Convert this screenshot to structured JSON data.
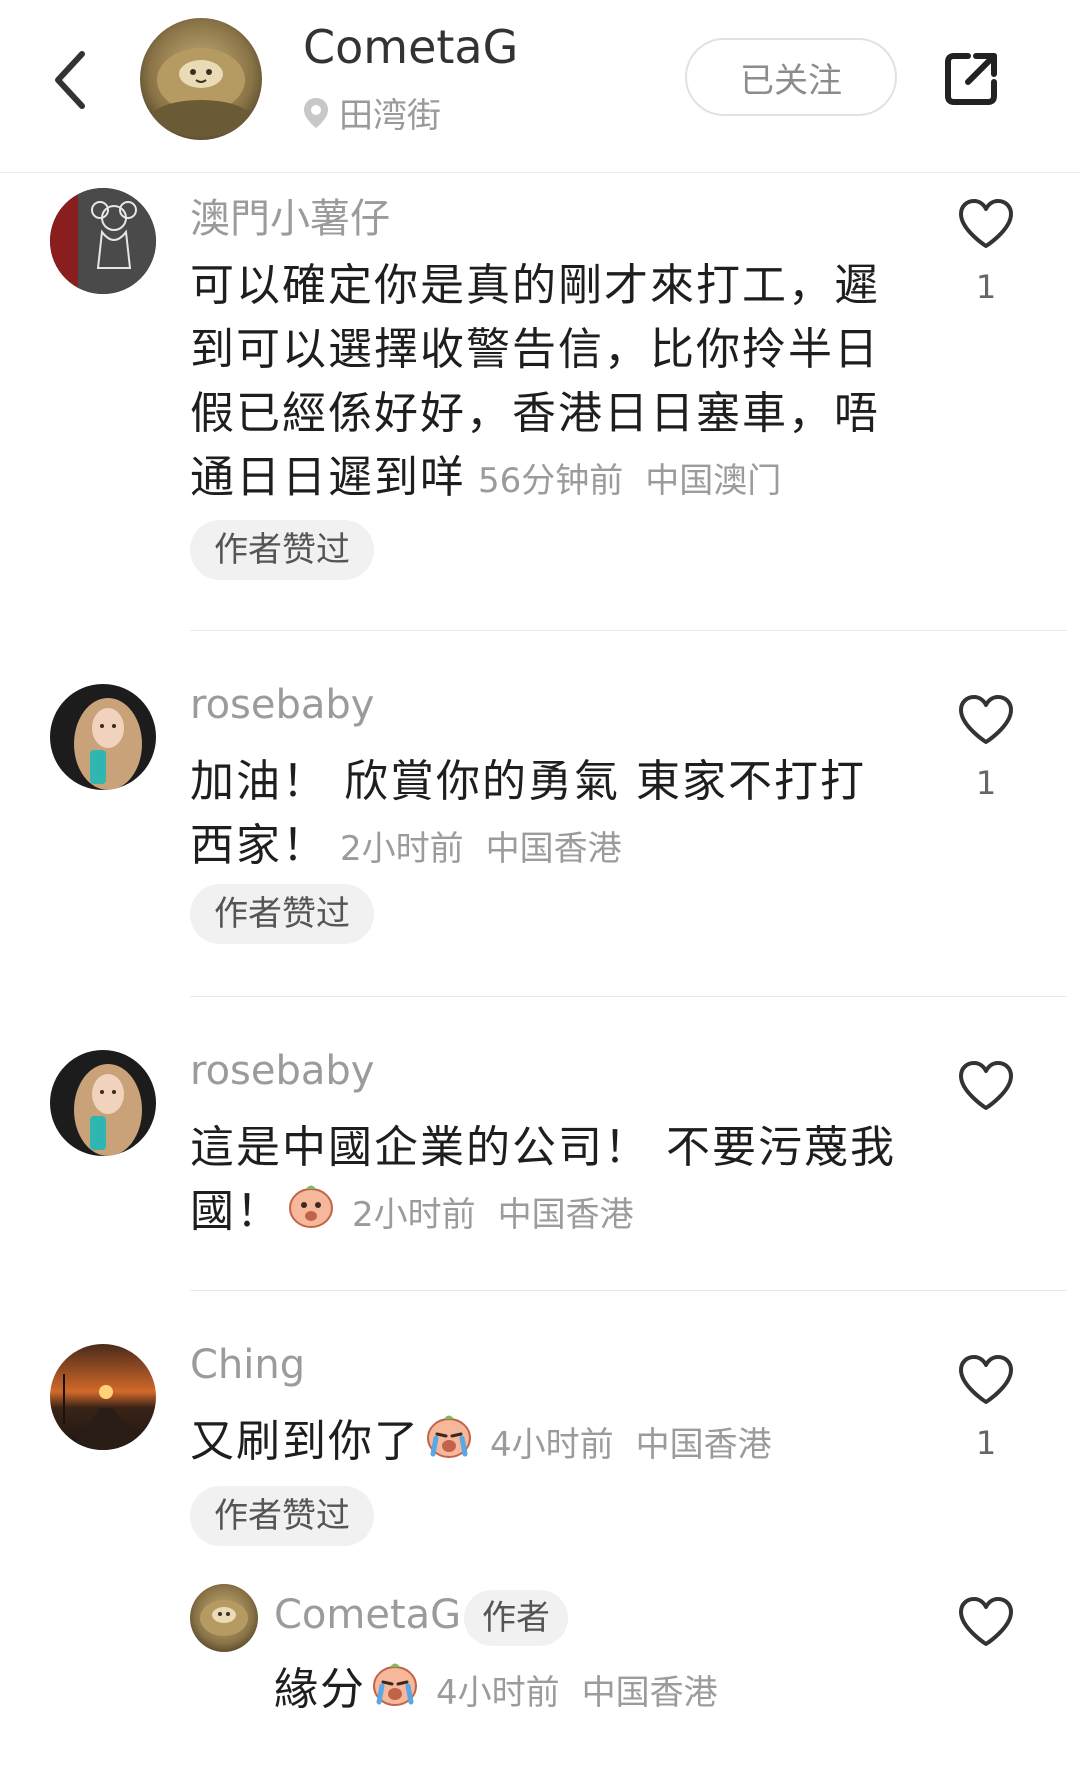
{
  "header": {
    "name": "CometaG",
    "location": "田湾街",
    "follow_label": "已关注",
    "back_icon": "chevron-left-icon",
    "share_icon": "share-external-icon"
  },
  "comments": [
    {
      "username": "澳門小薯仔",
      "text": "可以確定你是真的剛才來打工，遲到可以選擇收警告信，比你拎半日假已經係好好，香港日日塞車，唔通日日遲到咩",
      "time": "56分钟前",
      "region": "中国澳门",
      "badge": "作者赞过",
      "likes": "1"
    },
    {
      "username": "rosebaby",
      "text": "加油！ 欣賞你的勇氣 東家不打打西家！",
      "time": "2小时前",
      "region": "中国香港",
      "badge": "作者赞过",
      "likes": "1"
    },
    {
      "username": "rosebaby",
      "text": "這是中國企業的公司！ 不要污蔑我國！",
      "emoji": "shy-face-emoji",
      "time": "2小时前",
      "region": "中国香港",
      "likes": ""
    },
    {
      "username": "Ching",
      "text": "又刷到你了",
      "emoji": "crying-face-emoji",
      "time": "4小时前",
      "region": "中国香港",
      "badge": "作者赞过",
      "likes": "1"
    }
  ],
  "reply": {
    "username": "CometaG",
    "author_tag": "作者",
    "text": "緣分",
    "emoji": "crying-face-emoji",
    "time": "4小时前",
    "region": "中国香港",
    "likes": ""
  },
  "colors": {
    "text_primary": "#1e1e1e",
    "text_secondary": "#9b9b9b",
    "badge_bg": "#f1f1f1",
    "divider": "#e8e8e8"
  }
}
